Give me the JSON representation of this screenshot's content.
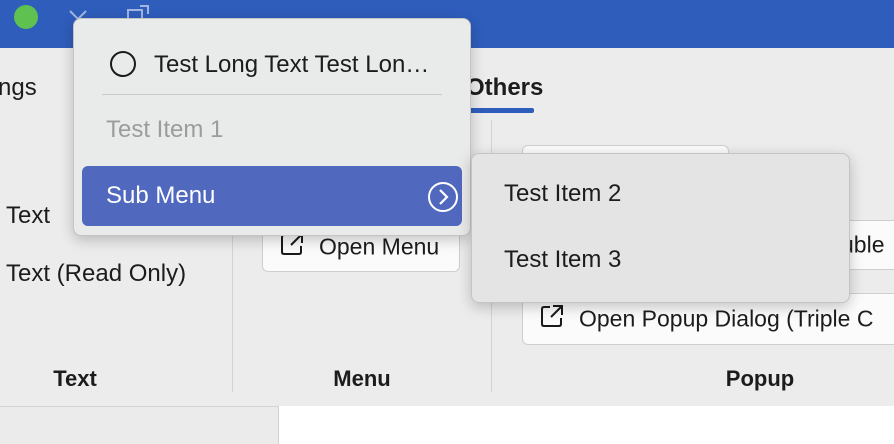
{
  "ribbon": {
    "tabs": {
      "partial_left": "ngs",
      "others": "Others"
    },
    "text_group": {
      "items": [
        "Text",
        "Text (Read Only)"
      ],
      "title": "Text"
    },
    "menu_group": {
      "button": "Open Menu",
      "title": "Menu"
    },
    "popup_group": {
      "button_double": "uble",
      "button_triple": "Open Popup Dialog (Triple C",
      "title": "Popup"
    }
  },
  "context_menu": {
    "items": [
      {
        "label": "Test Long Text Test Lon…"
      },
      {
        "label": "Test Item 1"
      },
      {
        "label": "Sub Menu"
      }
    ]
  },
  "submenu": {
    "items": [
      {
        "label": "Test Item 2"
      },
      {
        "label": "Test Item 3"
      }
    ]
  },
  "colors": {
    "titlebar": "#2f5dbc",
    "highlight": "#5069bf",
    "traffic_green": "#5fc14f"
  }
}
